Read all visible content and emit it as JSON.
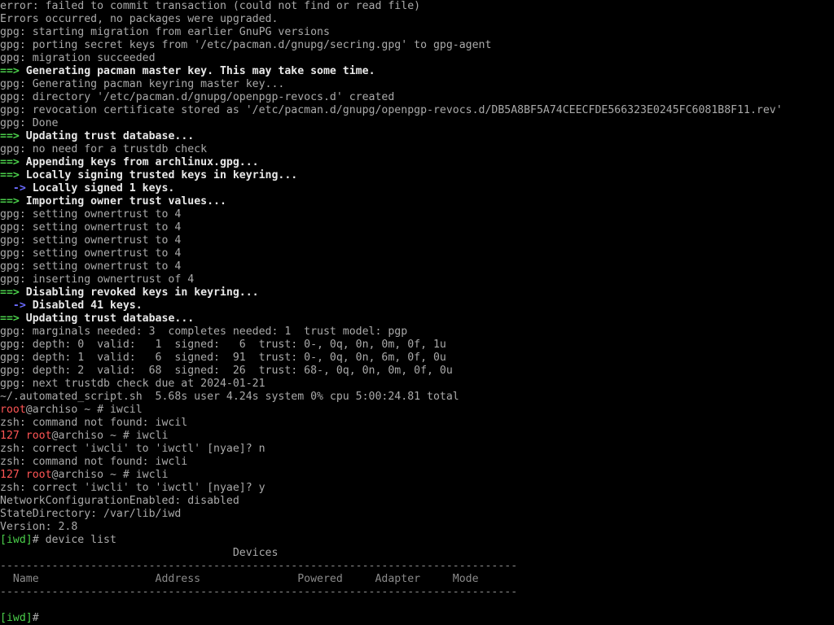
{
  "terminal": {
    "background": "#000000",
    "colors": {
      "text": "#aaaaaa",
      "bold_text": "#e8e8e8",
      "arrow_green": "#4bd04b",
      "arrow_blue": "#6a6aff",
      "root_red": "#ff5555"
    },
    "lines": [
      [
        {
          "t": "error: failed to commit transaction (could not find or read file)"
        }
      ],
      [
        {
          "t": "Errors occurred, no packages were upgraded."
        }
      ],
      [
        {
          "t": "gpg: starting migration from earlier GnuPG versions"
        }
      ],
      [
        {
          "t": "gpg: porting secret keys from '/etc/pacman.d/gnupg/secring.gpg' to gpg-agent"
        }
      ],
      [
        {
          "t": "gpg: migration succeeded"
        }
      ],
      [
        {
          "t": "==>",
          "c": "g b"
        },
        {
          "t": " Generating pacman master key. This may take some time.",
          "c": "w b"
        }
      ],
      [
        {
          "t": "gpg: Generating pacman keyring master key..."
        }
      ],
      [
        {
          "t": "gpg: directory '/etc/pacman.d/gnupg/openpgp-revocs.d' created"
        }
      ],
      [
        {
          "t": "gpg: revocation certificate stored as '/etc/pacman.d/gnupg/openpgp-revocs.d/DB5A8BF5A74CEECFDE566323E0245FC6081B8F11.rev'"
        }
      ],
      [
        {
          "t": "gpg: Done"
        }
      ],
      [
        {
          "t": "==>",
          "c": "g b"
        },
        {
          "t": " Updating trust database...",
          "c": "w b"
        }
      ],
      [
        {
          "t": "gpg: no need for a trustdb check"
        }
      ],
      [
        {
          "t": "==>",
          "c": "g b"
        },
        {
          "t": " Appending keys from archlinux.gpg...",
          "c": "w b"
        }
      ],
      [
        {
          "t": "==>",
          "c": "g b"
        },
        {
          "t": " Locally signing trusted keys in keyring...",
          "c": "w b"
        }
      ],
      [
        {
          "t": "  ->",
          "c": "bl b"
        },
        {
          "t": " Locally signed 1 keys.",
          "c": "w b"
        }
      ],
      [
        {
          "t": "==>",
          "c": "g b"
        },
        {
          "t": " Importing owner trust values...",
          "c": "w b"
        }
      ],
      [
        {
          "t": "gpg: setting ownertrust to 4"
        }
      ],
      [
        {
          "t": "gpg: setting ownertrust to 4"
        }
      ],
      [
        {
          "t": "gpg: setting ownertrust to 4"
        }
      ],
      [
        {
          "t": "gpg: setting ownertrust to 4"
        }
      ],
      [
        {
          "t": "gpg: setting ownertrust to 4"
        }
      ],
      [
        {
          "t": "gpg: inserting ownertrust of 4"
        }
      ],
      [
        {
          "t": "==>",
          "c": "g b"
        },
        {
          "t": " Disabling revoked keys in keyring...",
          "c": "w b"
        }
      ],
      [
        {
          "t": "  ->",
          "c": "bl b"
        },
        {
          "t": " Disabled 41 keys.",
          "c": "w b"
        }
      ],
      [
        {
          "t": "==>",
          "c": "g b"
        },
        {
          "t": " Updating trust database...",
          "c": "w b"
        }
      ],
      [
        {
          "t": "gpg: marginals needed: 3  completes needed: 1  trust model: pgp"
        }
      ],
      [
        {
          "t": "gpg: depth: 0  valid:   1  signed:   6  trust: 0-, 0q, 0n, 0m, 0f, 1u"
        }
      ],
      [
        {
          "t": "gpg: depth: 1  valid:   6  signed:  91  trust: 0-, 0q, 0n, 6m, 0f, 0u"
        }
      ],
      [
        {
          "t": "gpg: depth: 2  valid:  68  signed:  26  trust: 68-, 0q, 0n, 0m, 0f, 0u"
        }
      ],
      [
        {
          "t": "gpg: next trustdb check due at 2024-01-21"
        }
      ],
      [
        {
          "t": "~/.automated_script.sh  5.68s user 4.24s system 0% cpu 5:00:24.81 total"
        }
      ],
      [
        {
          "t": "root",
          "c": "r"
        },
        {
          "t": "@archiso ~ # iwcil"
        }
      ],
      [
        {
          "t": "zsh: command not found: iwcil"
        }
      ],
      [
        {
          "t": "127 ",
          "c": "r"
        },
        {
          "t": "root",
          "c": "r"
        },
        {
          "t": "@archiso ~ # iwcli"
        }
      ],
      [
        {
          "t": "zsh: correct 'iwcli' to 'iwctl' [nyae]? n"
        }
      ],
      [
        {
          "t": "zsh: command not found: iwcli"
        }
      ],
      [
        {
          "t": "127 ",
          "c": "r"
        },
        {
          "t": "root",
          "c": "r"
        },
        {
          "t": "@archiso ~ # iwcli"
        }
      ],
      [
        {
          "t": "zsh: correct 'iwcli' to 'iwctl' [nyae]? y"
        }
      ],
      [
        {
          "t": "NetworkConfigurationEnabled: disabled"
        }
      ],
      [
        {
          "t": "StateDirectory: /var/lib/iwd"
        }
      ],
      [
        {
          "t": "Version: 2.8"
        }
      ],
      [
        {
          "t": "[iwd]",
          "c": "g"
        },
        {
          "t": "# device list"
        }
      ],
      [
        {
          "t": "                                    Devices"
        }
      ],
      [
        {
          "t": "--------------------------------------------------------------------------------",
          "c": "rule"
        }
      ],
      [
        {
          "t": "  Name                  Address               Powered     Adapter     Mode",
          "c": "dim"
        }
      ],
      [
        {
          "t": "--------------------------------------------------------------------------------",
          "c": "rule"
        }
      ],
      [
        {
          "t": ""
        }
      ],
      [
        {
          "t": "[iwd]",
          "c": "g"
        },
        {
          "t": "# "
        }
      ]
    ]
  }
}
